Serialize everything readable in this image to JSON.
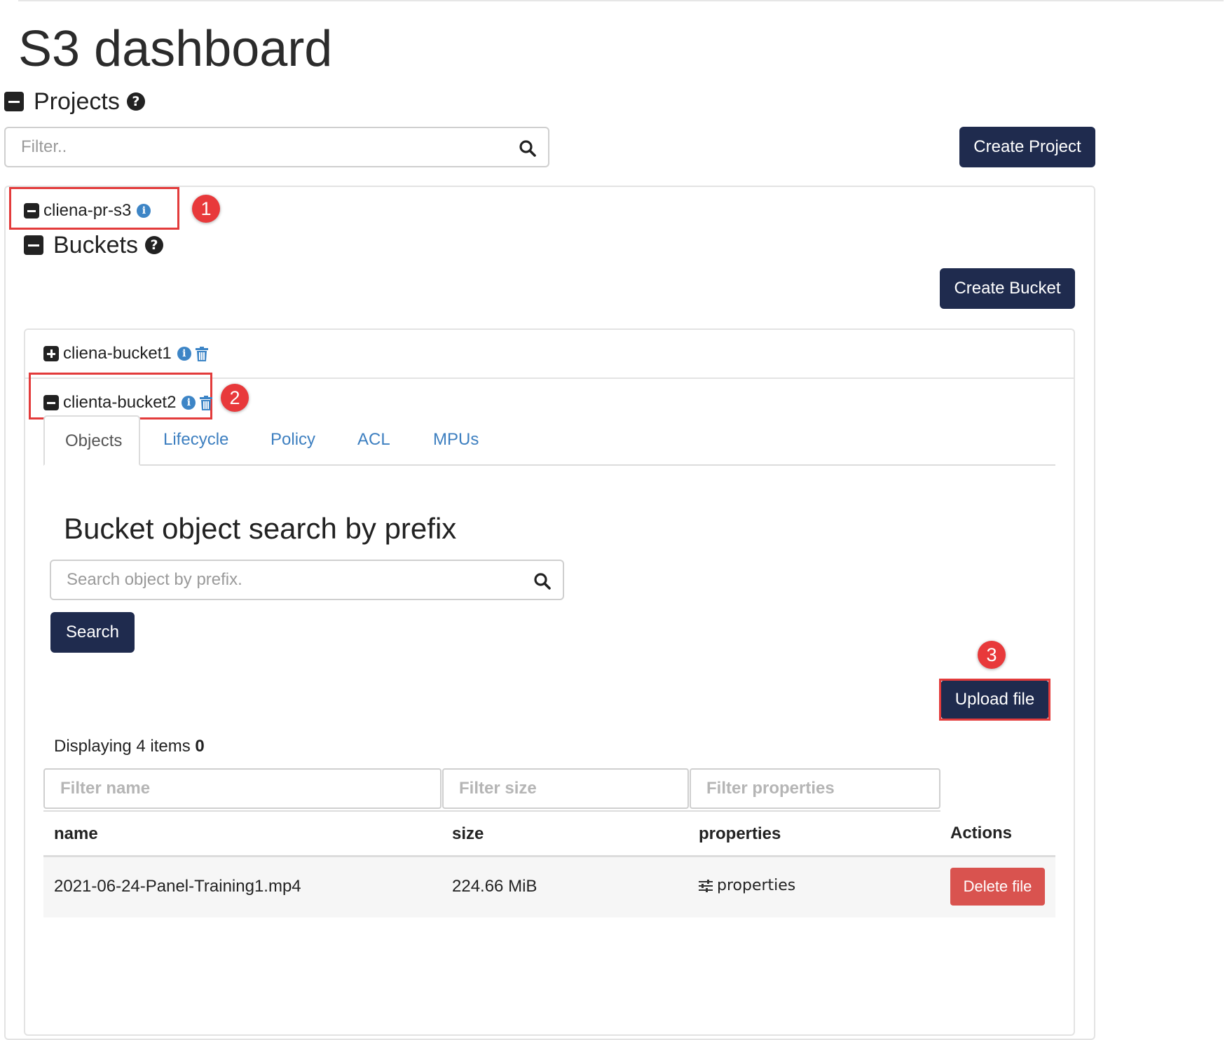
{
  "page": {
    "title": "S3 dashboard"
  },
  "projects": {
    "heading": "Projects",
    "filter_placeholder": "Filter..",
    "create_label": "Create Project",
    "project_name": "cliena-pr-s3"
  },
  "buckets": {
    "heading": "Buckets",
    "create_label": "Create Bucket",
    "items": [
      {
        "name": "cliena-bucket1",
        "expanded": false
      },
      {
        "name": "clienta-bucket2",
        "expanded": true
      }
    ]
  },
  "tabs": [
    {
      "label": "Objects",
      "active": true
    },
    {
      "label": "Lifecycle",
      "active": false
    },
    {
      "label": "Policy",
      "active": false
    },
    {
      "label": "ACL",
      "active": false
    },
    {
      "label": "MPUs",
      "active": false
    }
  ],
  "search": {
    "heading": "Bucket object search by prefix",
    "placeholder": "Search object by prefix.",
    "button_label": "Search"
  },
  "upload": {
    "label": "Upload file"
  },
  "listing": {
    "display_text": "Displaying 4 items",
    "display_count": "0",
    "filters": {
      "name": "Filter name",
      "size": "Filter size",
      "properties": "Filter properties"
    },
    "columns": [
      "name",
      "size",
      "properties",
      "Actions"
    ],
    "rows": [
      {
        "name": "2021-06-24-Panel-Training1.mp4",
        "size": "224.66 MiB",
        "properties": "properties",
        "action": "Delete file"
      }
    ]
  },
  "annotations": [
    "1",
    "2",
    "3"
  ],
  "colors": {
    "primary_button": "#1f2b4e",
    "danger_button": "#d9534f",
    "link": "#3d7fc0",
    "highlight": "#e33b3b"
  }
}
